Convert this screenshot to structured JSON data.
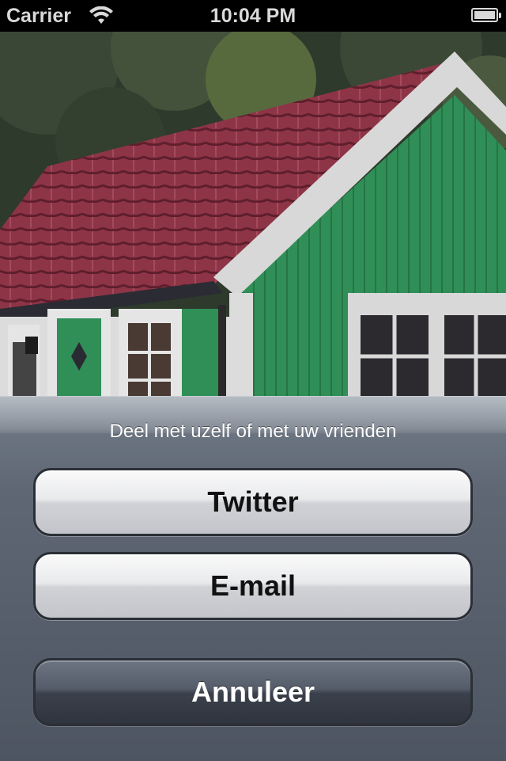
{
  "status_bar": {
    "carrier": "Carrier",
    "time": "10:04 PM",
    "icons": [
      "wifi-icon",
      "battery-icon"
    ]
  },
  "photo": {
    "description_icon": "house-photo",
    "colors": {
      "roof": "#8a2f44",
      "wall": "#2f8a52",
      "trim": "#e0e0e0",
      "sky": "#3b4a3c"
    }
  },
  "action_sheet": {
    "title": "Deel met uzelf of met uw vrienden",
    "buttons": {
      "twitter": "Twitter",
      "email": "E-mail",
      "cancel": "Annuleer"
    }
  }
}
